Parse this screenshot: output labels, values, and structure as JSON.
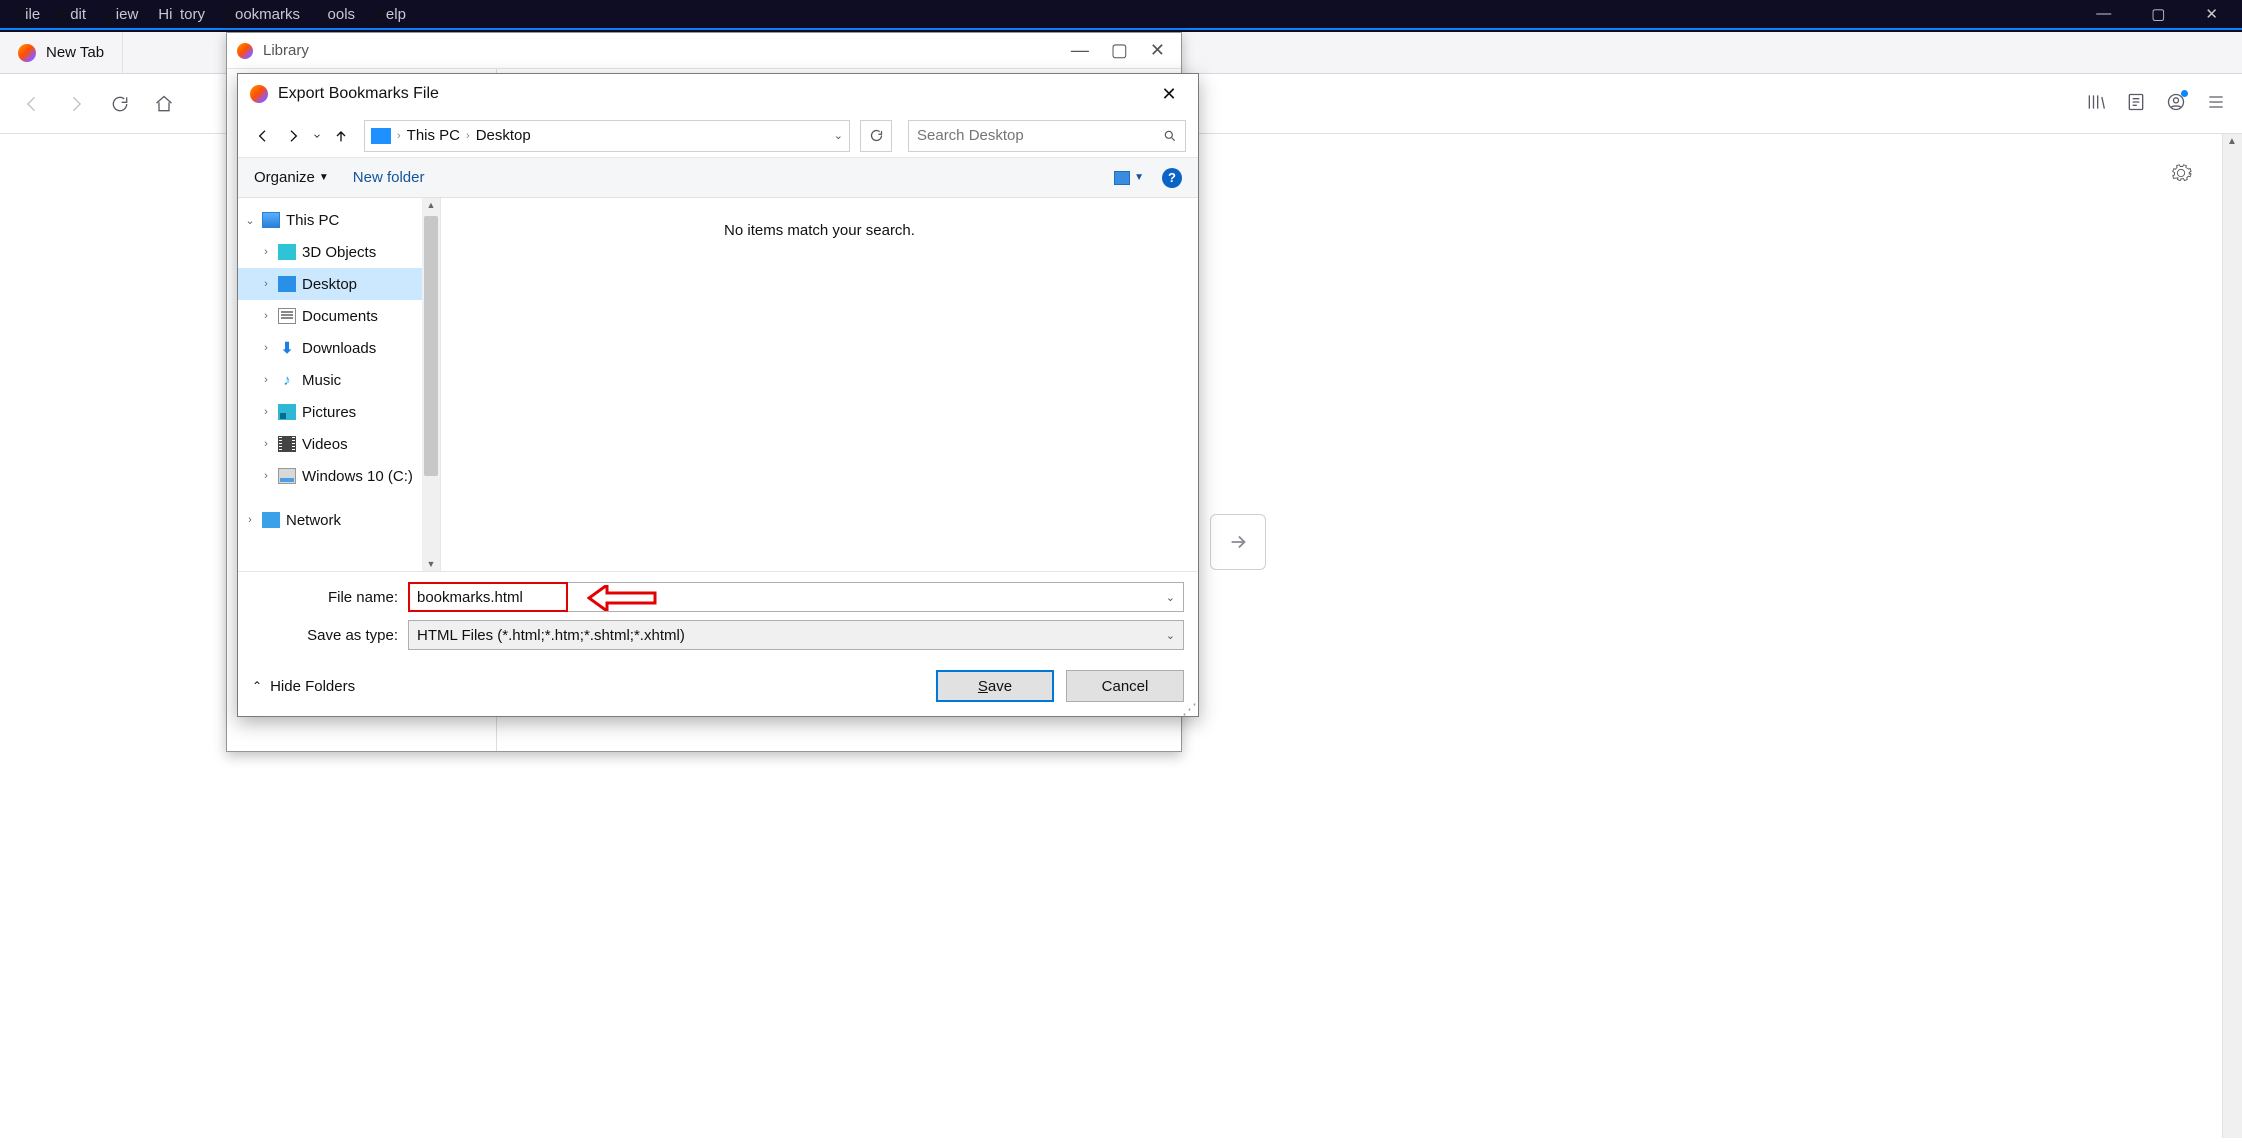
{
  "firefox": {
    "menu": {
      "file": "File",
      "edit": "Edit",
      "view": "View",
      "history": "History",
      "bookmarks": "Bookmarks",
      "tools": "Tools",
      "help": "Help"
    },
    "tab": {
      "title": "New Tab"
    }
  },
  "library": {
    "title": "Library"
  },
  "dialog": {
    "title": "Export Bookmarks File",
    "breadcrumb": {
      "root": "This PC",
      "leaf": "Desktop"
    },
    "search_placeholder": "Search Desktop",
    "toolbar": {
      "organize": "Organize",
      "newfolder": "New folder"
    },
    "empty_message": "No items match your search.",
    "tree": {
      "this_pc": "This PC",
      "items": [
        "3D Objects",
        "Desktop",
        "Documents",
        "Downloads",
        "Music",
        "Pictures",
        "Videos",
        "Windows 10 (C:)"
      ],
      "network": "Network"
    },
    "filename_label": "File name:",
    "filename_value": "bookmarks.html",
    "savetype_label": "Save as type:",
    "savetype_value": "HTML Files (*.html;*.htm;*.shtml;*.xhtml)",
    "hide_folders": "Hide Folders",
    "save": "Save",
    "cancel": "Cancel"
  }
}
